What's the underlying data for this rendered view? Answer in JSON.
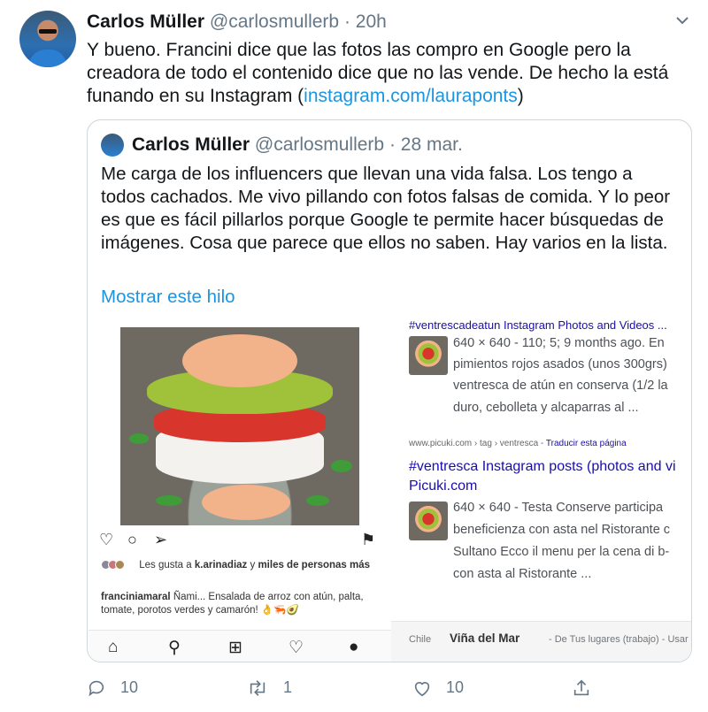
{
  "tweet": {
    "author_name": "Carlos Müller",
    "author_handle": "@carlosmullerb",
    "separator": "·",
    "time": "20h",
    "text_before_link": "Y bueno. Francini dice que las fotos las compro en Google pero la creadora de todo el contenido dice que no las vende. De hecho la está funando en su Instagram (",
    "link": "instagram.com/lauraponts",
    "text_after_link": ")",
    "reply_count": "10",
    "retweet_count": "1",
    "like_count": "10"
  },
  "quoted": {
    "author_name": "Carlos Müller",
    "author_handle": "@carlosmullerb",
    "separator": "·",
    "date": "28 mar.",
    "text": "Me carga de los influencers que llevan una vida falsa. Los tengo a todos cachados. Me vivo pillando con fotos falsas de comida. Y lo peor es que es fácil pillarlos porque Google te permite hacer búsquedas de imágenes. Cosa que parece que ellos no saben. Hay varios en la lista.",
    "show_thread": "Mostrar este hilo"
  },
  "instagram": {
    "likes_prefix": "Les gusta a ",
    "likes_user": "k.arinadiaz",
    "likes_mid": " y ",
    "likes_rest": "miles de personas más",
    "caption_user": "franciniamaral",
    "caption_text": " Ñami... Ensalada de arroz con atún, palta, tomate, porotos verdes y camarón! 👌🦐🥑"
  },
  "google": {
    "result1_title_partial": "#ventrescadeatun Instagram Photos and Videos ...",
    "result1_lines": [
      "640 × 640 - 110; 5; 9 months ago. En",
      "pimientos rojos asados (unos 300grs)",
      "ventresca de atún en conserva (1/2 la",
      "duro, cebolleta y alcaparras al  ..."
    ],
    "result2_url": "www.picuki.com › tag › ventresca - ",
    "result2_translate": "Traducir esta página",
    "result2_title_line1": "#ventresca Instagram posts (photos and vi",
    "result2_title_line2": "Picuki.com",
    "result2_lines": [
      "640 × 640 - Testa Conserve participa",
      "beneficienza con asta nel Ristorante c",
      "Sultano Ecco il menu per la cena di b-",
      "con asta al Ristorante ..."
    ],
    "footer_country": "Chile",
    "footer_city": "Viña del Mar",
    "footer_rest": "- De Tus lugares (trabajo) - Usar la ub"
  },
  "colors": {
    "link": "#1b95e0",
    "muted": "#657786",
    "google_link": "#1a0dab"
  }
}
